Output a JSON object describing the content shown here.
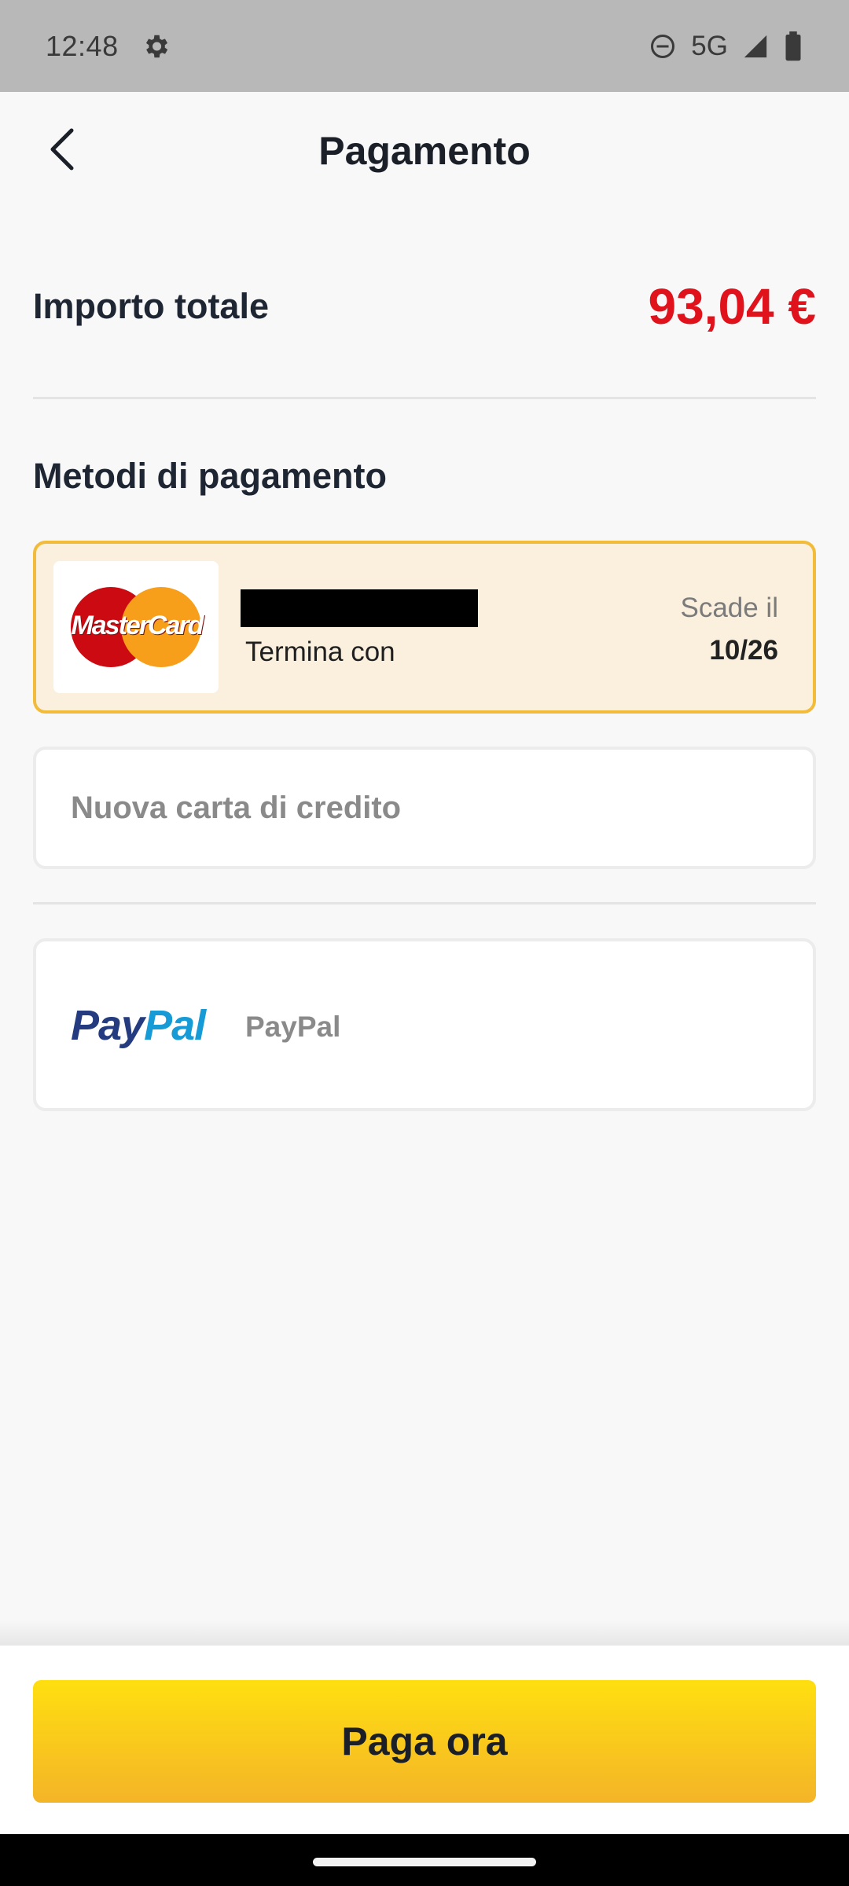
{
  "status_bar": {
    "time": "12:48",
    "network": "5G",
    "icons": [
      "gear-icon",
      "do-not-disturb-icon",
      "signal-icon",
      "battery-icon"
    ]
  },
  "header": {
    "title": "Pagamento",
    "back_icon": "chevron-left-icon"
  },
  "total": {
    "label": "Importo totale",
    "amount": "93,04 €"
  },
  "payment_methods": {
    "title": "Metodi di pagamento",
    "saved_card": {
      "brand_logo": "MasterCard",
      "ends_with_label": "Termina con",
      "expiry_label": "Scade il",
      "expiry_value": "10/26",
      "selected": true
    },
    "new_card": {
      "label": "Nuova carta di credito"
    },
    "paypal": {
      "logo_pay": "Pay",
      "logo_pal": "Pal",
      "label": "PayPal"
    }
  },
  "footer": {
    "pay_button_label": "Paga ora"
  },
  "colors": {
    "accent": "#f2bc3a",
    "amount": "#e0121c",
    "button_top": "#ffdf10",
    "button_bottom": "#f4b428"
  }
}
